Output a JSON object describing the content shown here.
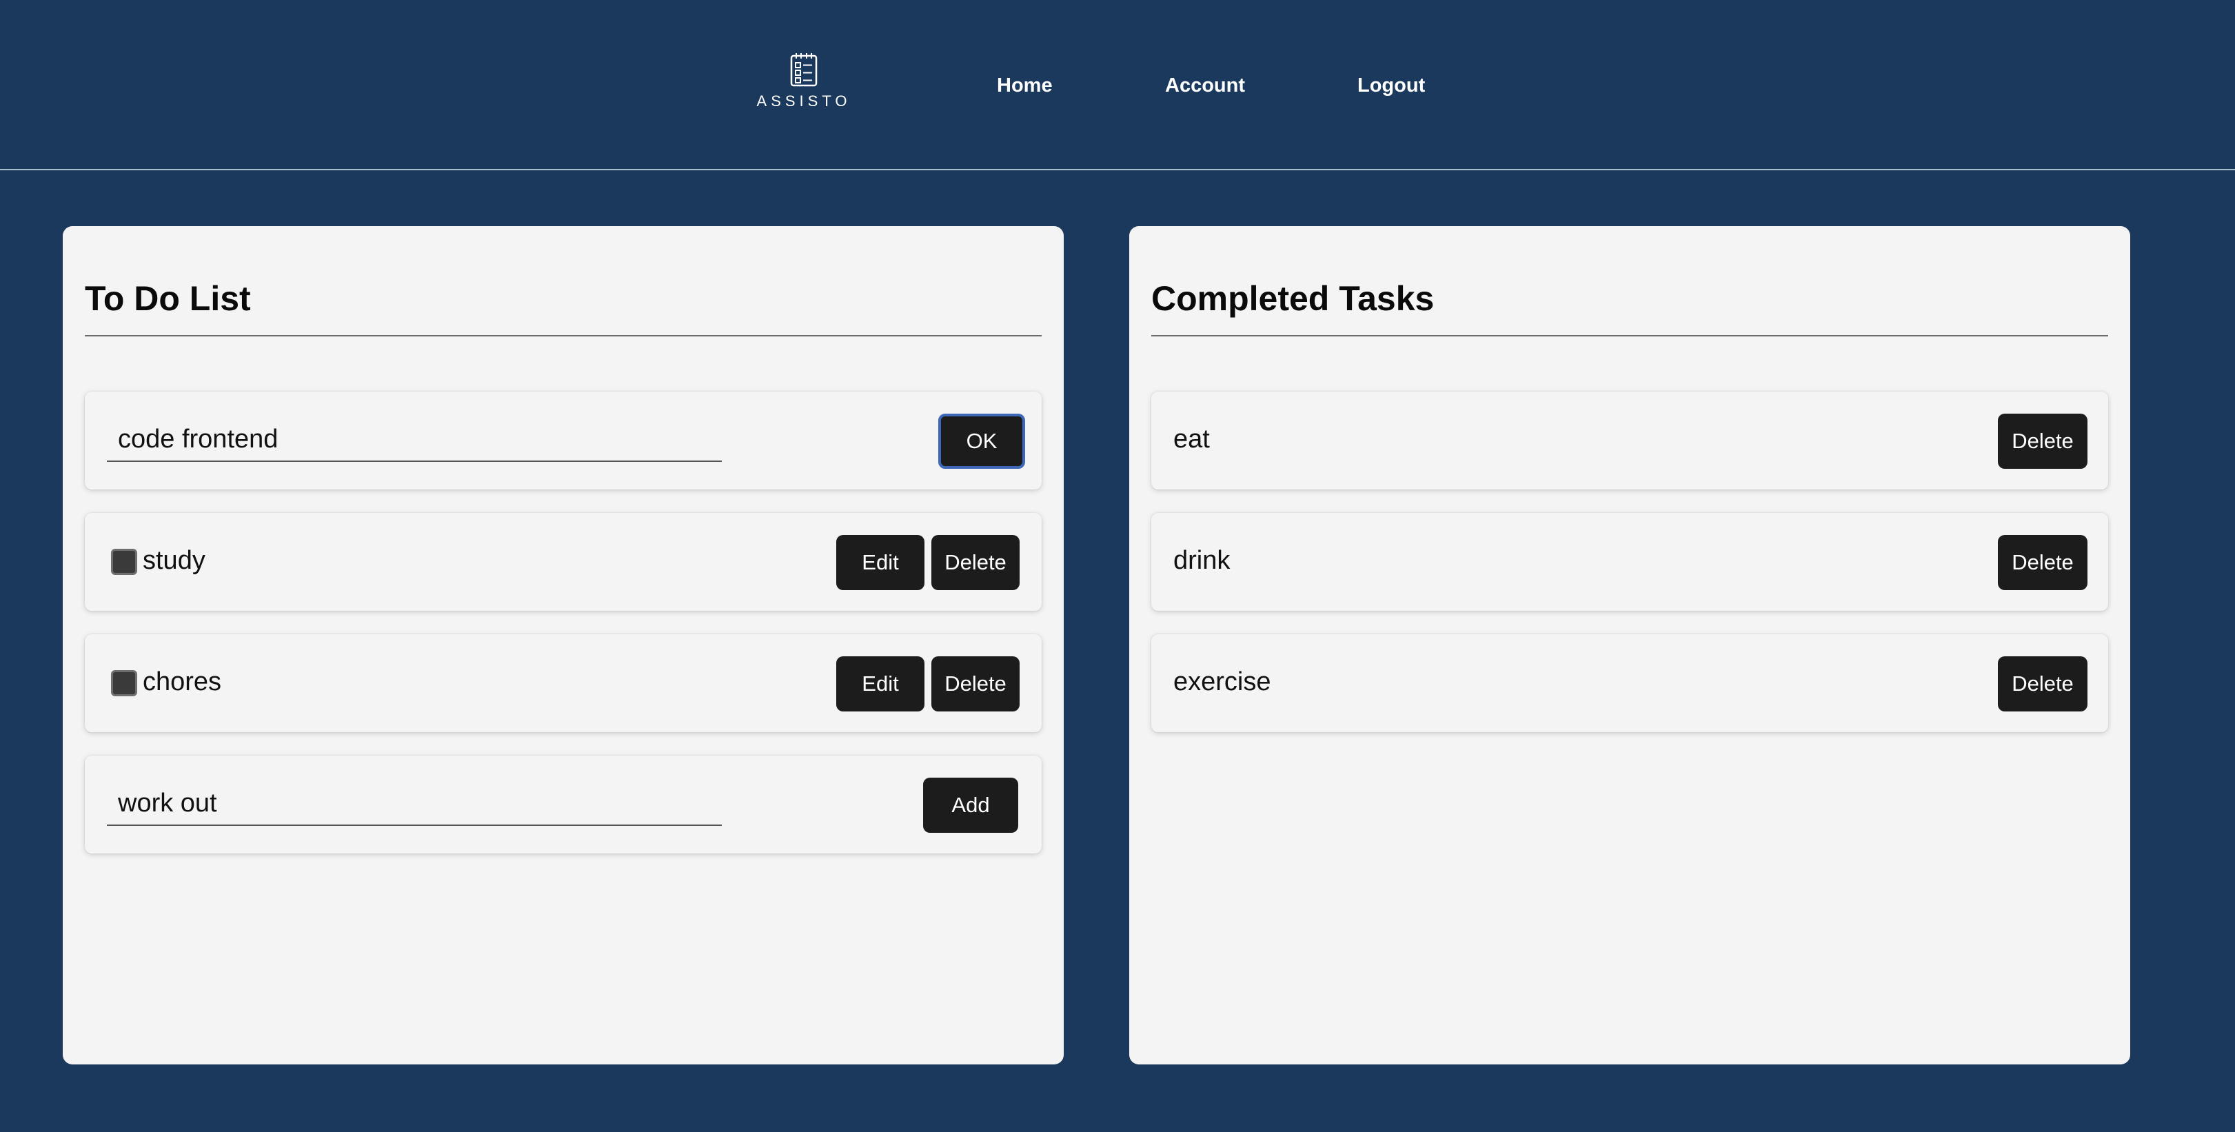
{
  "header": {
    "logo_text": "ASSISTO",
    "logo_icon": "checklist-notepad-icon",
    "nav": {
      "home": "Home",
      "account": "Account",
      "logout": "Logout"
    }
  },
  "todo": {
    "title": "To Do List",
    "edit_row": {
      "value": "code frontend",
      "ok_label": "OK"
    },
    "tasks": [
      {
        "label": "study",
        "checked": false,
        "edit_label": "Edit",
        "delete_label": "Delete"
      },
      {
        "label": "chores",
        "checked": false,
        "edit_label": "Edit",
        "delete_label": "Delete"
      }
    ],
    "new_task": {
      "value": "work out",
      "add_label": "Add"
    }
  },
  "completed": {
    "title": "Completed Tasks",
    "tasks": [
      {
        "label": "eat",
        "delete_label": "Delete"
      },
      {
        "label": "drink",
        "delete_label": "Delete"
      },
      {
        "label": "exercise",
        "delete_label": "Delete"
      }
    ]
  },
  "colors": {
    "background": "#1b395d",
    "panel": "#f4f4f4",
    "button": "#1c1c1c",
    "focus_ring": "#3d68b8"
  }
}
